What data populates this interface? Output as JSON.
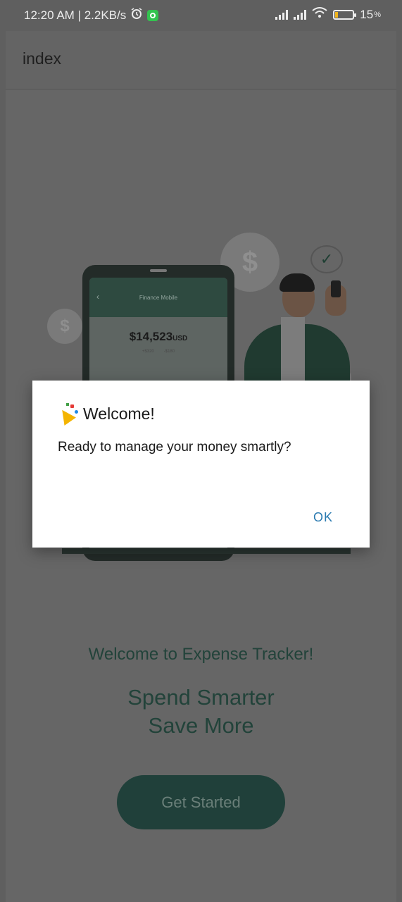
{
  "status_bar": {
    "time_speed": "12:20 AM | 2.2KB/s",
    "battery_percent": "15",
    "battery_level": 0.15,
    "icons": [
      "alarm-icon",
      "whatsapp-icon",
      "signal-icon",
      "signal-icon",
      "wifi-icon",
      "battery-icon"
    ]
  },
  "app_bar": {
    "title": "index"
  },
  "illustration": {
    "phone_screen_title": "Finance Mobile",
    "balance_amount": "$14,523",
    "balance_currency": "USD",
    "income": "+$320",
    "expense": "-$180"
  },
  "dialog": {
    "title": "Welcome!",
    "message": "Ready to manage your money smartly?",
    "ok_label": "OK"
  },
  "main": {
    "welcome_text": "Welcome to Expense Tracker!",
    "tagline_line1": "Spend Smarter",
    "tagline_line2": "Save More",
    "cta_label": "Get Started"
  },
  "colors": {
    "overlay": "#5f5f5f",
    "brand_dark": "#20403a",
    "dialog_button": "#2a7ab0"
  }
}
